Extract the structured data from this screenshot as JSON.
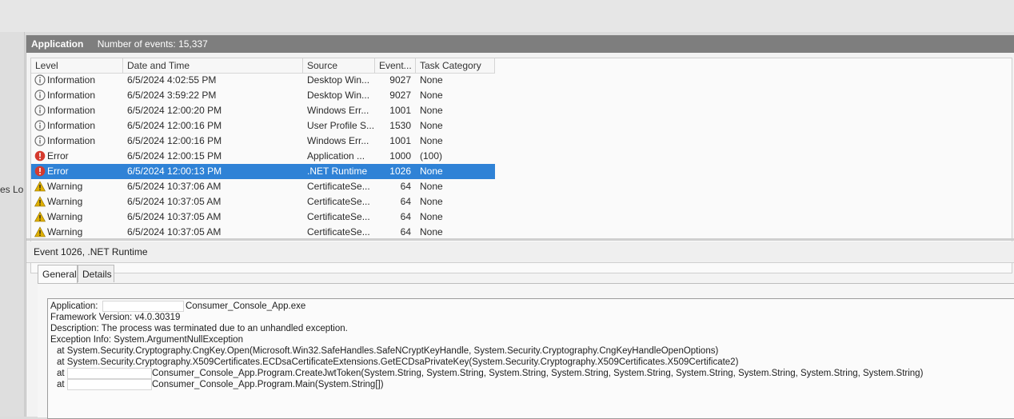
{
  "left_pane": {
    "clipped_text": "es Lo"
  },
  "log": {
    "name": "Application",
    "count_label": "Number of events: 15,337"
  },
  "columns": {
    "level": "Level",
    "date": "Date and Time",
    "source": "Source",
    "event": "Event...",
    "category": "Task Category"
  },
  "events": [
    {
      "level": "Information",
      "icon": "info-icon",
      "date": "6/5/2024 4:02:55 PM",
      "source": "Desktop Win...",
      "event": "9027",
      "category": "None"
    },
    {
      "level": "Information",
      "icon": "info-icon",
      "date": "6/5/2024 3:59:22 PM",
      "source": "Desktop Win...",
      "event": "9027",
      "category": "None"
    },
    {
      "level": "Information",
      "icon": "info-icon",
      "date": "6/5/2024 12:00:20 PM",
      "source": "Windows Err...",
      "event": "1001",
      "category": "None"
    },
    {
      "level": "Information",
      "icon": "info-icon",
      "date": "6/5/2024 12:00:16 PM",
      "source": "User Profile S...",
      "event": "1530",
      "category": "None"
    },
    {
      "level": "Information",
      "icon": "info-icon",
      "date": "6/5/2024 12:00:16 PM",
      "source": "Windows Err...",
      "event": "1001",
      "category": "None"
    },
    {
      "level": "Error",
      "icon": "error-icon",
      "date": "6/5/2024 12:00:15 PM",
      "source": "Application ...",
      "event": "1000",
      "category": "(100)"
    },
    {
      "level": "Error",
      "icon": "error-icon",
      "date": "6/5/2024 12:00:13 PM",
      "source": ".NET Runtime",
      "event": "1026",
      "category": "None",
      "selected": true
    },
    {
      "level": "Warning",
      "icon": "warning-icon",
      "date": "6/5/2024 10:37:06 AM",
      "source": "CertificateSe...",
      "event": "64",
      "category": "None"
    },
    {
      "level": "Warning",
      "icon": "warning-icon",
      "date": "6/5/2024 10:37:05 AM",
      "source": "CertificateSe...",
      "event": "64",
      "category": "None"
    },
    {
      "level": "Warning",
      "icon": "warning-icon",
      "date": "6/5/2024 10:37:05 AM",
      "source": "CertificateSe...",
      "event": "64",
      "category": "None"
    },
    {
      "level": "Warning",
      "icon": "warning-icon",
      "date": "6/5/2024 10:37:05 AM",
      "source": "CertificateSe...",
      "event": "64",
      "category": "None"
    }
  ],
  "detail": {
    "header": "Event 1026, .NET Runtime",
    "tabs": [
      "General",
      "Details"
    ],
    "lines": [
      "Application:",
      "Consumer_Console_App.exe",
      "Framework Version: v4.0.30319",
      "Description: The process was terminated due to an unhandled exception.",
      "Exception Info: System.ArgumentNullException",
      "at System.Security.Cryptography.CngKey.Open(Microsoft.Win32.SafeHandles.SafeNCryptKeyHandle, System.Security.Cryptography.CngKeyHandleOpenOptions)",
      "at System.Security.Cryptography.X509Certificates.ECDsaCertificateExtensions.GetECDsaPrivateKey(System.Security.Cryptography.X509Certificates.X509Certificate2)",
      "at",
      "Consumer_Console_App.Program.CreateJwtToken(System.String, System.String, System.String, System.String, System.String, System.String, System.String, System.String, System.String)",
      "at",
      "Consumer_Console_App.Program.Main(System.String[])"
    ]
  },
  "colors": {
    "selection": "#2f82d6",
    "titlebar": "#7e7e7e",
    "info": "#6b6b6b",
    "error": "#d53a2e",
    "warning": "#e0b000"
  }
}
